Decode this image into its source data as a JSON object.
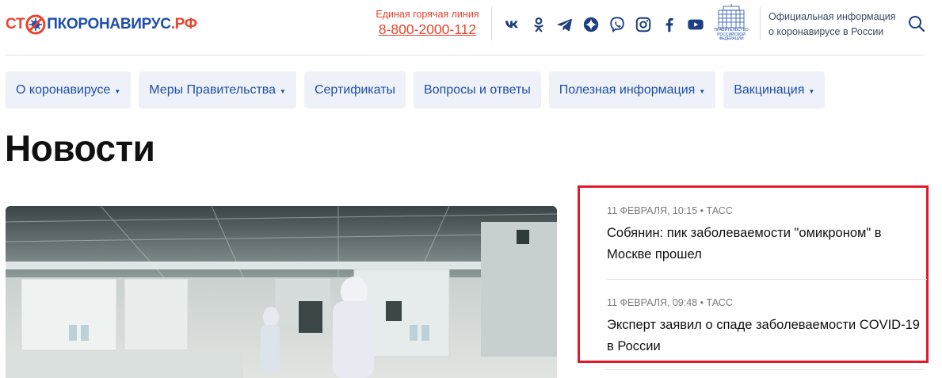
{
  "header": {
    "logo": {
      "part_a": "СТ",
      "part_b": "ПКОРОНАВИРУС",
      "domain": ".РФ"
    },
    "hotline": {
      "label": "Единая горячая линия",
      "phone": "8-800-2000-112"
    },
    "socials": [
      "vk-icon",
      "odnoklassniki-icon",
      "telegram-icon",
      "yandex-zen-icon",
      "viber-icon",
      "instagram-icon",
      "facebook-icon",
      "youtube-icon"
    ],
    "gov_caption": "ПРАВИТЕЛЬСТВО РОССИЙСКОЙ ФЕДЕРАЦИИ",
    "official_line1": "Официальная информация",
    "official_line2": "о коронавирусе в России"
  },
  "nav": [
    {
      "label": "О коронавирусе",
      "dropdown": true
    },
    {
      "label": "Меры Правительства",
      "dropdown": true
    },
    {
      "label": "Сертификаты",
      "dropdown": false
    },
    {
      "label": "Вопросы и ответы",
      "dropdown": false
    },
    {
      "label": "Полезная информация",
      "dropdown": true
    },
    {
      "label": "Вакцинация",
      "dropdown": true
    }
  ],
  "page": {
    "title": "Новости"
  },
  "news": [
    {
      "meta": "11 ФЕВРАЛЯ, 10:15 • ТАСС",
      "title": "Собянин: пик заболеваемости \"омикроном\" в Москве прошел"
    },
    {
      "meta": "11 ФЕВРАЛЯ, 09:48 • ТАСС",
      "title": "Эксперт заявил о спаде заболеваемости COVID-19 в России"
    }
  ],
  "colors": {
    "brand_red": "#e8442c",
    "brand_blue": "#1e4ea8",
    "nav_bg": "#eef2f8",
    "highlight_border": "#e11a2b"
  }
}
